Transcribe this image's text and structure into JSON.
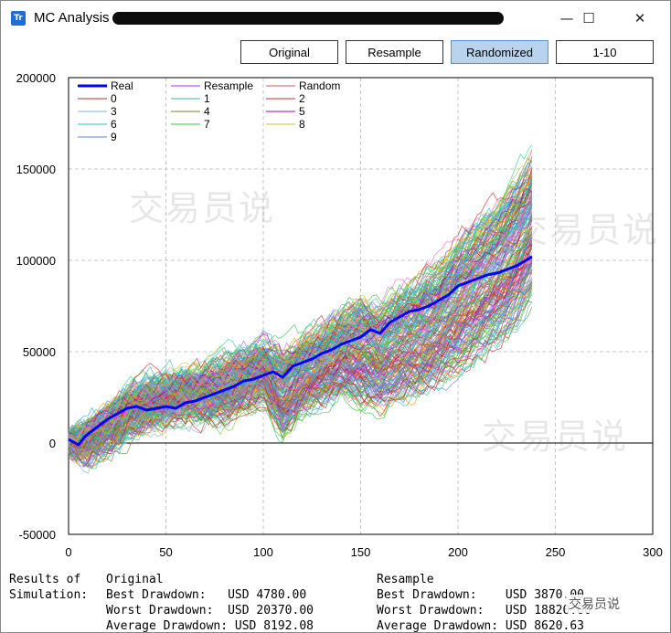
{
  "window": {
    "title": "MC Analysis -",
    "icon": "app-icon",
    "controls": {
      "minimize": "—",
      "maximize": "☐",
      "close": "✕"
    }
  },
  "toolbar": {
    "original_label": "Original",
    "resample_label": "Resample",
    "randomized_label": "Randomized",
    "range_label": "1-10"
  },
  "watermarks": [
    "交易员说",
    "交易员说",
    "交易员说"
  ],
  "chart_data": {
    "type": "line",
    "xlim": [
      0,
      300
    ],
    "ylim": [
      -50000,
      200000
    ],
    "x_ticks": [
      "0",
      "50",
      "100",
      "150",
      "200",
      "250",
      "300"
    ],
    "y_ticks": [
      "200000",
      "150000",
      "100000",
      "50000",
      "0",
      "-50000"
    ],
    "grid": true,
    "legend_position": "top-left",
    "legend": [
      {
        "name": "Real",
        "color": "#0000ff"
      },
      {
        "name": "Resample",
        "color": "#9b30ff"
      },
      {
        "name": "Random",
        "color": "#c06060"
      },
      {
        "name": "0",
        "color": "#b03030"
      },
      {
        "name": "1",
        "color": "#40b0b0"
      },
      {
        "name": "2",
        "color": "#c03030"
      },
      {
        "name": "3",
        "color": "#7fb0e0"
      },
      {
        "name": "4",
        "color": "#808030"
      },
      {
        "name": "5",
        "color": "#b000b0"
      },
      {
        "name": "6",
        "color": "#30c0b0"
      },
      {
        "name": "7",
        "color": "#40c040"
      },
      {
        "name": "8",
        "color": "#d0c040"
      },
      {
        "name": "9",
        "color": "#6080e0"
      }
    ],
    "real_series": {
      "name": "Real",
      "x": [
        0,
        5,
        8,
        10,
        15,
        20,
        25,
        30,
        35,
        40,
        45,
        50,
        55,
        60,
        65,
        70,
        75,
        80,
        85,
        90,
        95,
        100,
        105,
        110,
        115,
        120,
        125,
        130,
        135,
        140,
        145,
        150,
        155,
        160,
        165,
        170,
        175,
        180,
        185,
        190,
        195,
        200,
        205,
        210,
        215,
        220,
        225,
        230,
        235,
        238
      ],
      "y": [
        2000,
        -1000,
        3000,
        5000,
        9000,
        13000,
        16000,
        19000,
        20000,
        18000,
        19000,
        20000,
        19000,
        22000,
        23000,
        25000,
        27000,
        29000,
        31000,
        34000,
        35000,
        37000,
        39000,
        36000,
        42000,
        44000,
        46000,
        49000,
        51000,
        54000,
        56000,
        58000,
        62000,
        60000,
        66000,
        69000,
        72000,
        73000,
        75000,
        78000,
        81000,
        86000,
        88000,
        90000,
        92000,
        93000,
        95000,
        97000,
        100000,
        102000
      ]
    },
    "simulation_count": 200,
    "envelope": {
      "x": [
        0,
        10,
        20,
        30,
        40,
        50,
        60,
        70,
        80,
        90,
        100,
        110,
        120,
        130,
        140,
        150,
        160,
        170,
        180,
        190,
        200,
        210,
        220,
        230,
        238
      ],
      "upper": [
        5000,
        12000,
        20000,
        30000,
        36000,
        38000,
        40000,
        44000,
        48000,
        55000,
        60000,
        58000,
        64000,
        70000,
        78000,
        90000,
        85000,
        95000,
        100000,
        110000,
        125000,
        135000,
        145000,
        160000,
        170000
      ],
      "lower": [
        -5000,
        -10000,
        -5000,
        2000,
        8000,
        10000,
        12000,
        12000,
        10000,
        15000,
        18000,
        -5000,
        10000,
        15000,
        20000,
        10000,
        8000,
        12000,
        15000,
        20000,
        25000,
        35000,
        40000,
        50000,
        65000
      ]
    }
  },
  "summary": {
    "label_line1": "Results of",
    "label_line2": "Simulation:",
    "original": {
      "heading": "Original",
      "best_label": "Best Drawdown:",
      "best_value": "USD 4780.00",
      "worst_label": "Worst Drawdown:",
      "worst_value": "USD 20370.00",
      "avg_label": "Average Drawdown:",
      "avg_value": "USD 8192.08"
    },
    "resample": {
      "heading": "Resample",
      "best_label": "Best Drawdown:",
      "best_value": "USD 3870.00",
      "worst_label": "Worst Drawdown:",
      "worst_value": "USD 18820.00",
      "avg_label": "Average Drawdown:",
      "avg_value": "USD 8620.63"
    }
  },
  "footer_badge": "交易员说"
}
